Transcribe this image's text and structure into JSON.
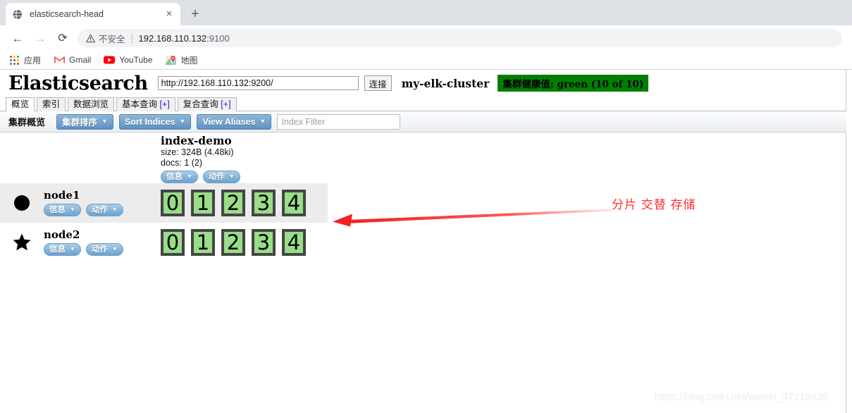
{
  "browser": {
    "tab": {
      "title": "elasticsearch-head",
      "favicon": "globe-icon",
      "close": "×"
    },
    "new_tab_label": "+",
    "nav": {
      "back": "←",
      "forward": "→",
      "reload": "⟳"
    },
    "omnibox": {
      "warning_label": "不安全",
      "url_host": "192.168.110.132",
      "url_port": ":9100"
    },
    "bookmarks": [
      {
        "label": "应用",
        "icon": "apps-grid-icon"
      },
      {
        "label": "Gmail",
        "icon": "gmail-icon"
      },
      {
        "label": "YouTube",
        "icon": "youtube-icon"
      },
      {
        "label": "地图",
        "icon": "maps-pin-icon"
      }
    ]
  },
  "app": {
    "logo": "Elasticsearch",
    "url_value": "http://192.168.110.132:9200/",
    "url_placeholder": "http://localhost:9200/",
    "connect_label": "连接",
    "cluster_name": "my-elk-cluster",
    "health_badge": "集群健康值: green (10 of 10)",
    "health_color": "#008000",
    "tabs": [
      {
        "label": "概览",
        "active": true,
        "plus": ""
      },
      {
        "label": "索引",
        "active": false,
        "plus": ""
      },
      {
        "label": "数据浏览",
        "active": false,
        "plus": ""
      },
      {
        "label": "基本查询",
        "active": false,
        "plus": "[+]"
      },
      {
        "label": "复合查询",
        "active": false,
        "plus": "[+]"
      }
    ],
    "toolbar": {
      "title": "集群概览",
      "sort_cluster_label": "集群排序",
      "sort_indices_label": "Sort Indices",
      "view_aliases_label": "View Aliases",
      "filter_placeholder": "Index Filter",
      "filter_value": "",
      "caret": "▼"
    },
    "index": {
      "name": "index-demo",
      "size": "size: 324B (4.48ki)",
      "docs": "docs: 1 (2)",
      "info_label": "信息",
      "action_label": "动作",
      "caret": "▼"
    },
    "nodes": [
      {
        "name": "node1",
        "icon": "circle-node-icon",
        "highlighted": true,
        "info_label": "信息",
        "action_label": "动作",
        "caret": "▼",
        "shards": [
          {
            "label": "0",
            "type": "primary"
          },
          {
            "label": "1",
            "type": "primary"
          },
          {
            "label": "2",
            "type": "primary"
          },
          {
            "label": "3",
            "type": "primary"
          },
          {
            "label": "4",
            "type": "primary"
          }
        ]
      },
      {
        "name": "node2",
        "icon": "star-master-icon",
        "highlighted": false,
        "info_label": "信息",
        "action_label": "动作",
        "caret": "▼",
        "shards": [
          {
            "label": "0",
            "type": "replica"
          },
          {
            "label": "1",
            "type": "replica"
          },
          {
            "label": "2",
            "type": "replica"
          },
          {
            "label": "3",
            "type": "replica"
          },
          {
            "label": "4",
            "type": "replica"
          }
        ]
      }
    ]
  },
  "annotation": {
    "text": "分片 交替 存储",
    "color": "#ff2d2d",
    "arrow": "left-arrow-annotation"
  },
  "watermark": "https://blog.csdn.net/weixin_47219935"
}
